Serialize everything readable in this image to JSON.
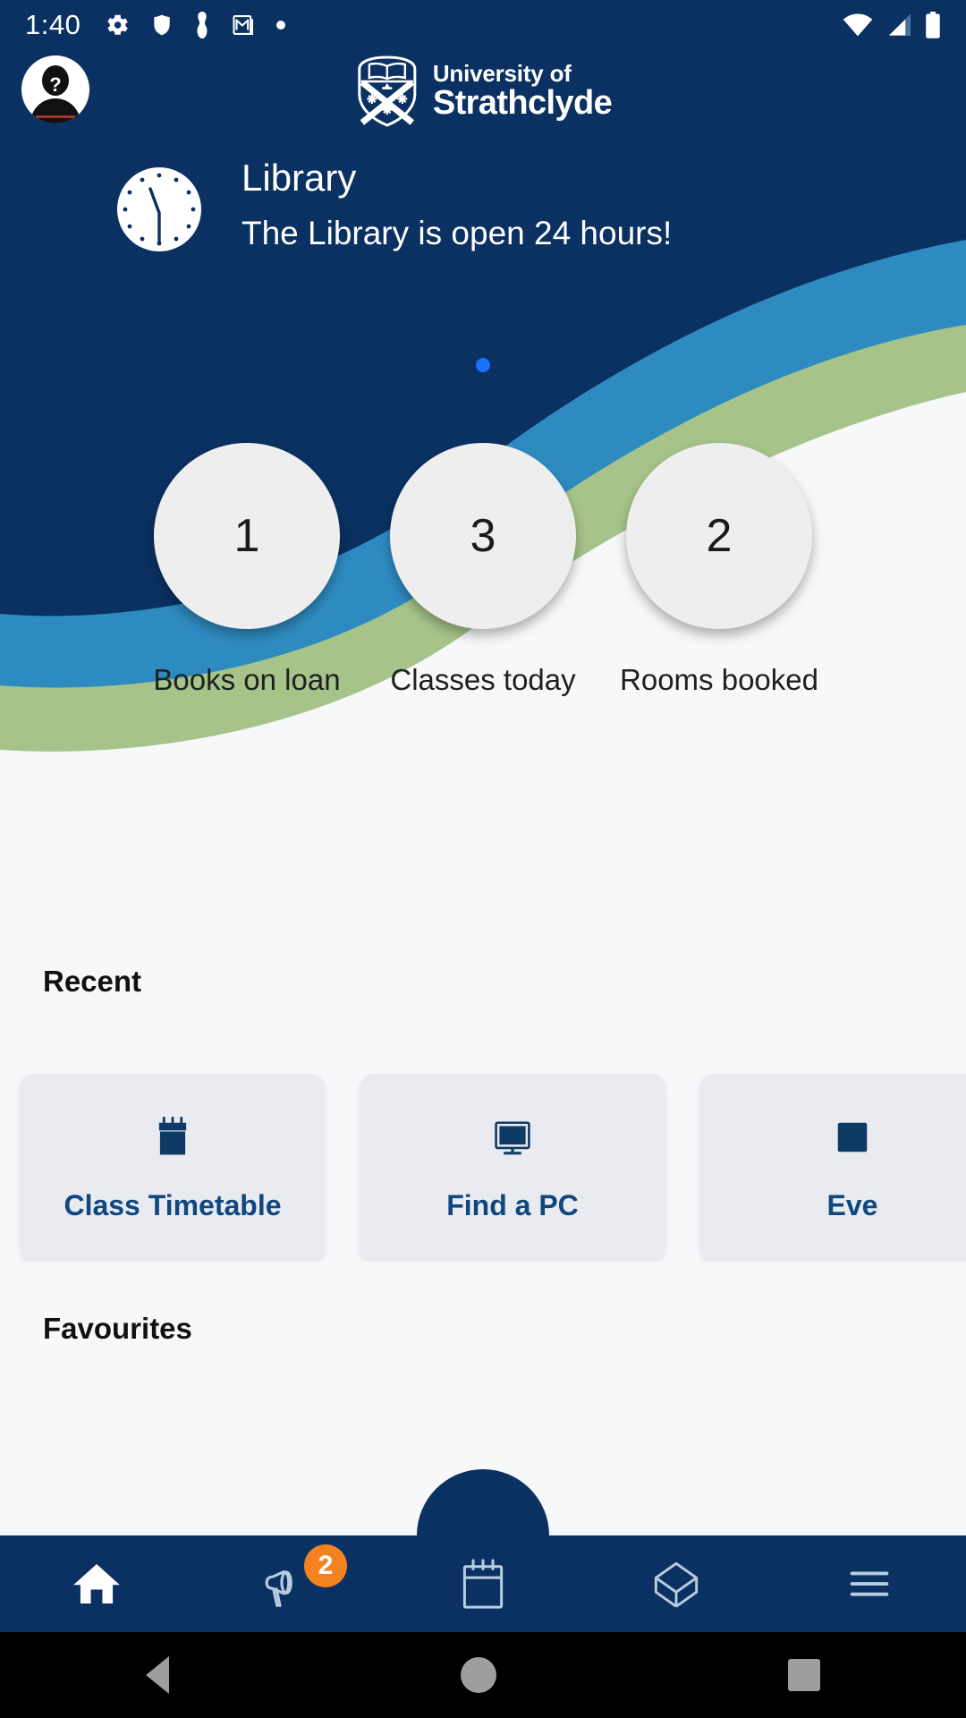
{
  "statusbar": {
    "time": "1:40",
    "left_icons": [
      "gear-icon",
      "shield-icon",
      "key-icon",
      "gmail-icon",
      "dot-icon"
    ],
    "right_icons": [
      "wifi-icon",
      "cellular-signal-icon",
      "battery-icon"
    ]
  },
  "header": {
    "avatar": "user-avatar",
    "brand_line1": "University of",
    "brand_line2": "Strathclyde",
    "crest": "strathclyde-crest-icon",
    "background": "#0a3161"
  },
  "hero": {
    "icon": "clock-icon",
    "title": "Library",
    "subtitle": "The Library is open 24 hours!",
    "pager": {
      "count": 1,
      "active_index": 0,
      "active_color": "#1a73ff"
    },
    "colors": {
      "navy": "#0a3161",
      "blue": "#2e8bc0",
      "green": "#a6c48a"
    }
  },
  "stats": [
    {
      "value": "1",
      "label": "Books on loan"
    },
    {
      "value": "3",
      "label": "Classes today"
    },
    {
      "value": "2",
      "label": "Rooms booked"
    }
  ],
  "sections": {
    "recent_title": "Recent",
    "favourites_title": "Favourites"
  },
  "recent_cards": [
    {
      "label": "Class Timetable",
      "icon": "calendar-icon"
    },
    {
      "label": "Find a PC",
      "icon": "monitor-icon"
    },
    {
      "label": "Eve",
      "icon": "events-icon"
    }
  ],
  "bottomnav": {
    "items": [
      {
        "name": "home",
        "icon": "home-icon",
        "active": true,
        "badge": null
      },
      {
        "name": "announcements",
        "icon": "megaphone-icon",
        "active": false,
        "badge": "2"
      },
      {
        "name": "calendar",
        "icon": "calendar-outline-icon",
        "active": false,
        "badge": null
      },
      {
        "name": "study",
        "icon": "graduation-cap-icon",
        "active": false,
        "badge": null
      },
      {
        "name": "menu",
        "icon": "hamburger-menu-icon",
        "active": false,
        "badge": null
      }
    ],
    "badge_color": "#f58220",
    "background": "#0a3161"
  },
  "sysnav": {
    "back": "back-triangle-icon",
    "home": "home-circle-icon",
    "recents": "recents-square-icon"
  }
}
